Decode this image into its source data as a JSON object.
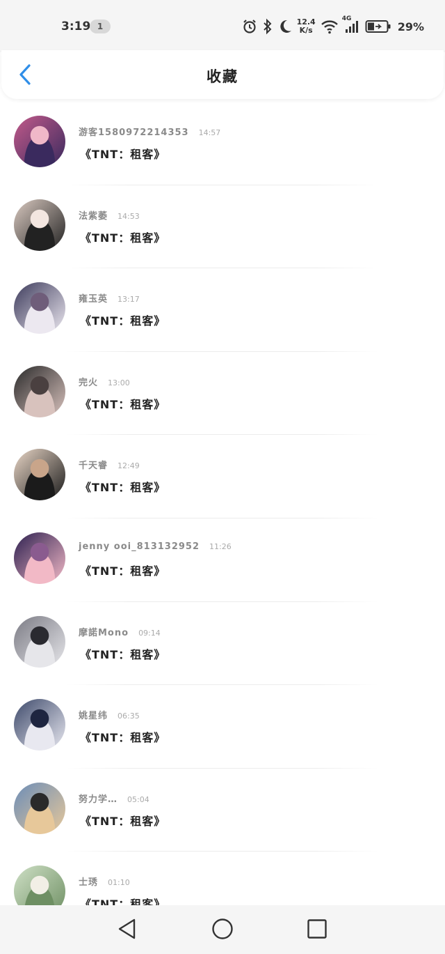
{
  "status_bar": {
    "time": "3:19",
    "notification_count": "1",
    "net_speed_value": "12.4",
    "net_speed_unit": "K/s",
    "network_type": "4G",
    "battery": "29%"
  },
  "header": {
    "title": "收藏"
  },
  "items": [
    {
      "name": "游客1580972214353",
      "time": "14:57",
      "title": "《TNT：租客》",
      "avatar_colors": [
        "#c25a8a",
        "#3a2a5e",
        "#f0b8c8"
      ]
    },
    {
      "name": "法紫萎",
      "time": "14:53",
      "title": "《TNT：租客》",
      "avatar_colors": [
        "#d9c9c0",
        "#222222",
        "#f3e6e0"
      ]
    },
    {
      "name": "雍玉英",
      "time": "13:17",
      "title": "《TNT：租客》",
      "avatar_colors": [
        "#3d3b5c",
        "#ece8f0",
        "#6f5d7a"
      ]
    },
    {
      "name": "完火",
      "time": "13:00",
      "title": "《TNT：租客》",
      "avatar_colors": [
        "#2a2a2a",
        "#d8c2bd",
        "#4a4040"
      ]
    },
    {
      "name": "千天睿",
      "time": "12:49",
      "title": "《TNT：租客》",
      "avatar_colors": [
        "#e9d6c6",
        "#1b1b1b",
        "#c9a58a"
      ]
    },
    {
      "name": "jenny ooi_813132952",
      "time": "11:26",
      "title": "《TNT：租客》",
      "avatar_colors": [
        "#2d2050",
        "#f2b9c6",
        "#8a5b8f"
      ]
    },
    {
      "name": "摩諾Mono",
      "time": "09:14",
      "title": "《TNT：租客》",
      "avatar_colors": [
        "#7b7b84",
        "#e6e6ea",
        "#2a2a30"
      ]
    },
    {
      "name": "姚星纬",
      "time": "06:35",
      "title": "《TNT：租客》",
      "avatar_colors": [
        "#3e4a6b",
        "#e8e8f0",
        "#1e2540"
      ]
    },
    {
      "name": "努力学…",
      "time": "05:04",
      "title": "《TNT：租客》",
      "avatar_colors": [
        "#6c8db7",
        "#e7c89a",
        "#2a2a2a"
      ]
    },
    {
      "name": "士琇",
      "time": "01:10",
      "title": "《TNT：租客》",
      "avatar_colors": [
        "#cfe0c6",
        "#6e8f63",
        "#f2efe6"
      ]
    }
  ],
  "nav": {
    "back_icon": "triangle-back-icon",
    "home_icon": "circle-home-icon",
    "recents_icon": "square-recents-icon"
  },
  "colors": {
    "accent": "#2f8ee8",
    "text_primary": "#222222",
    "text_secondary": "#8a8a8a"
  }
}
